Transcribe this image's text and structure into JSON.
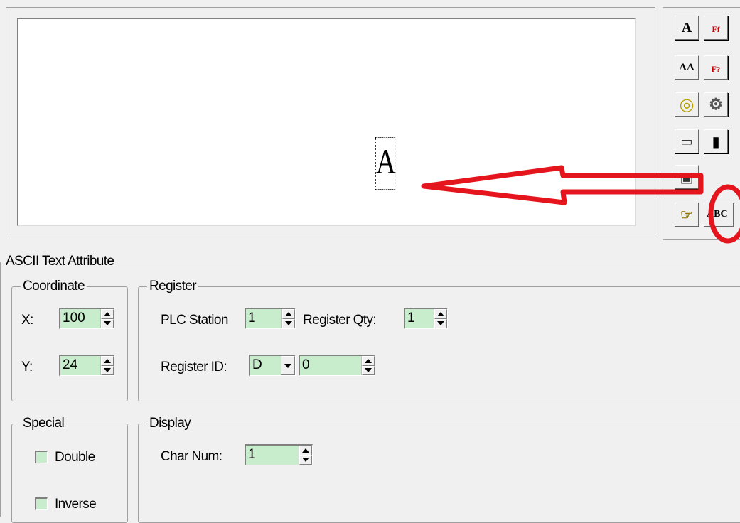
{
  "preview": {
    "sample_char": "A"
  },
  "toolbox": {
    "tools": [
      {
        "icon": "text-tool-icon",
        "glyph": "A"
      },
      {
        "icon": "font-function-icon",
        "glyph": "F",
        "sub": "f"
      },
      {
        "icon": "rotate-text-icon",
        "glyph": "AA"
      },
      {
        "icon": "font-function-alt-icon",
        "glyph": "F",
        "sub": "?"
      },
      {
        "icon": "lamp-icon",
        "glyph": "◎"
      },
      {
        "icon": "gear-icon",
        "glyph": "⚙"
      },
      {
        "icon": "keyboard-icon",
        "glyph": "▭"
      },
      {
        "icon": "meter-icon",
        "glyph": "▮"
      },
      {
        "icon": "numeric-input-icon",
        "glyph": "▣"
      },
      {
        "icon": "hand-pointer-icon",
        "glyph": "☞"
      },
      {
        "icon": "ascii-text-icon",
        "glyph": "ABC"
      }
    ]
  },
  "attribute": {
    "title": "ASCII Text Attribute",
    "coordinate": {
      "title": "Coordinate",
      "x_label": "X:",
      "x_value": "100",
      "y_label": "Y:",
      "y_value": "24"
    },
    "register": {
      "title": "Register",
      "plc_station_label": "PLC Station",
      "plc_station_value": "1",
      "qty_label": "Register Qty:",
      "qty_value": "1",
      "id_label": "Register ID:",
      "id_type": "D",
      "id_value": "0"
    },
    "special": {
      "title": "Special",
      "double_label": "Double",
      "inverse_label": "Inverse"
    },
    "display": {
      "title": "Display",
      "char_num_label": "Char Num:",
      "char_num_value": "1"
    }
  },
  "colors": {
    "field_bg": "#c7edcc",
    "annotation": "#e4151d"
  }
}
